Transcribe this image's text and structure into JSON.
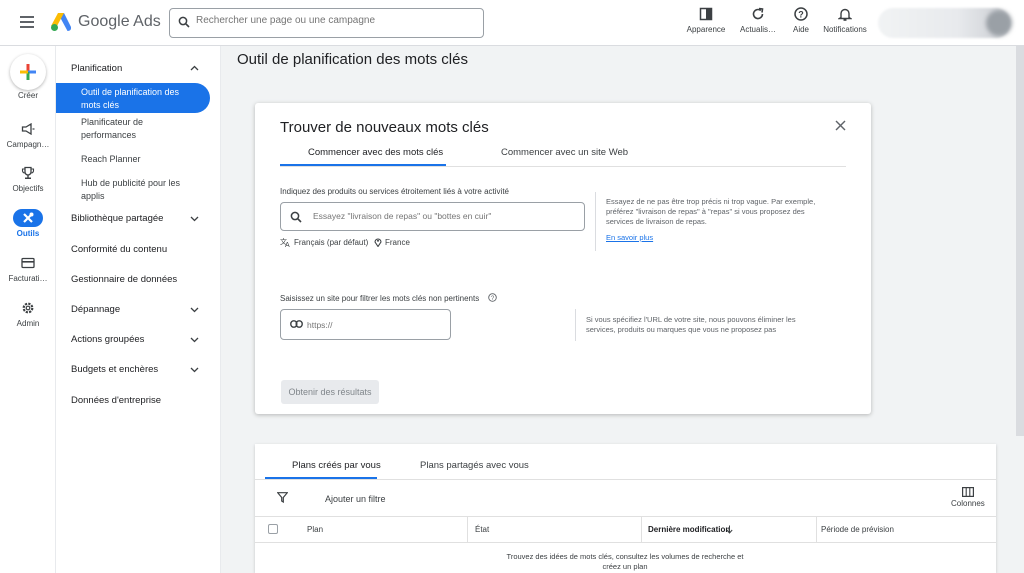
{
  "header": {
    "brand": "Google Ads",
    "search_placeholder": "Rechercher une page ou une campagne",
    "tools": [
      {
        "label": "Apparence",
        "icon": "appearance-icon"
      },
      {
        "label": "Actualis…",
        "icon": "refresh-icon"
      },
      {
        "label": "Aide",
        "icon": "help-icon"
      },
      {
        "label": "Notifications",
        "icon": "bell-icon"
      }
    ]
  },
  "rail": {
    "create": "Créer",
    "items": [
      {
        "label": "Campagn…",
        "icon": "megaphone-icon"
      },
      {
        "label": "Objectifs",
        "icon": "trophy-icon"
      },
      {
        "label": "Outils",
        "icon": "tools-icon",
        "active": true
      },
      {
        "label": "Facturati…",
        "icon": "credit-card-icon"
      },
      {
        "label": "Admin",
        "icon": "gear-icon"
      }
    ]
  },
  "nav": {
    "planning": "Planification",
    "sub": [
      "Outil de planification des mots clés",
      "Planificateur de performances",
      "Reach Planner",
      "Hub de publicité pour les applis"
    ],
    "sections": [
      "Bibliothèque partagée",
      "Conformité du contenu",
      "Gestionnaire de données",
      "Dépannage",
      "Actions groupées",
      "Budgets et enchères",
      "Données d'entreprise"
    ]
  },
  "main": {
    "title": "Outil de planification des mots clés"
  },
  "card": {
    "title": "Trouver de nouveaux mots clés",
    "tabs": [
      "Commencer avec des mots clés",
      "Commencer avec un site Web"
    ],
    "kw_label": "Indiquez des produits ou services étroitement liés à votre activité",
    "kw_placeholder": "Essayez \"livraison de repas\" ou \"bottes en cuir\"",
    "language": "Français (par défaut)",
    "location": "France",
    "kw_hint": [
      "Essayez de ne pas être trop précis ni trop vague. Par exemple,",
      "préférez \"livraison de repas\" à \"repas\" si vous proposez des",
      "services de livraison de repas."
    ],
    "learn_more": "En savoir plus",
    "url_label": "Saisissez un site pour filtrer les mots clés non pertinents",
    "url_placeholder": "https://",
    "url_hint": [
      "Si vous spécifiez l'URL de votre site, nous pouvons éliminer les",
      "services, produits ou marques que vous ne proposez pas"
    ],
    "results_button": "Obtenir des résultats"
  },
  "plans": {
    "tabs": [
      "Plans créés par vous",
      "Plans partagés avec vous"
    ],
    "add_filter": "Ajouter un filtre",
    "columns_button": "Colonnes",
    "headers": [
      "Plan",
      "État",
      "Dernière modification",
      "Période de prévision"
    ],
    "empty": [
      "Trouvez des idées de mots clés, consultez les volumes de recherche et",
      "créez un plan"
    ]
  },
  "colors": {
    "accent": "#1a73e8",
    "background": "#f1f3f4"
  }
}
